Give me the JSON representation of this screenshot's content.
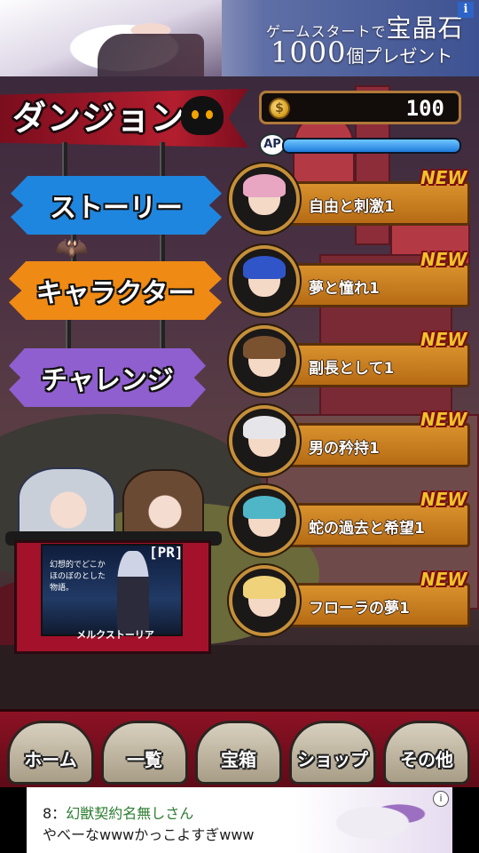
{
  "top_ad": {
    "line1_prefix": "ゲームスタートで",
    "line1_big": "宝晶石",
    "line2_big": "1000",
    "line2_suffix": "個プレゼント",
    "info_icon": "i"
  },
  "header": {
    "title": "ダンジョン",
    "coins": "100",
    "coin_symbol": "$",
    "ap_label": "AP",
    "ap_fill_fraction": 1.0
  },
  "signs": [
    {
      "label": "ストーリー",
      "color": "#1f86e0"
    },
    {
      "label": "キャラクター",
      "color": "#ef8a14"
    },
    {
      "label": "チャレンジ",
      "color": "#8f5fcf"
    }
  ],
  "pr": {
    "tag": "[PR]",
    "copy": "幻想的でどこかほのぼのとした物語。",
    "caption": "メルクストーリア"
  },
  "chapters": [
    {
      "label": "自由と刺激1",
      "badge": "NEW",
      "hair": "#e8a6c3"
    },
    {
      "label": "夢と憧れ1",
      "badge": "NEW",
      "hair": "#2f55c9"
    },
    {
      "label": "副長として1",
      "badge": "NEW",
      "hair": "#7a5230"
    },
    {
      "label": "男の矜持1",
      "badge": "NEW",
      "hair": "#e6e6ea"
    },
    {
      "label": "蛇の過去と希望1",
      "badge": "NEW",
      "hair": "#4fb6c8"
    },
    {
      "label": "フローラの夢1",
      "badge": "NEW",
      "hair": "#f0d27a"
    }
  ],
  "nav": [
    {
      "label": "ホーム"
    },
    {
      "label": "一覧"
    },
    {
      "label": "宝箱"
    },
    {
      "label": "ショップ"
    },
    {
      "label": "その他"
    }
  ],
  "bottom_ad": {
    "line1_prefix": "8：",
    "line1_name": "幻獣契約名無しさん",
    "line2": "やべーなwwwかっこよすぎwww",
    "info_icon": "i"
  }
}
